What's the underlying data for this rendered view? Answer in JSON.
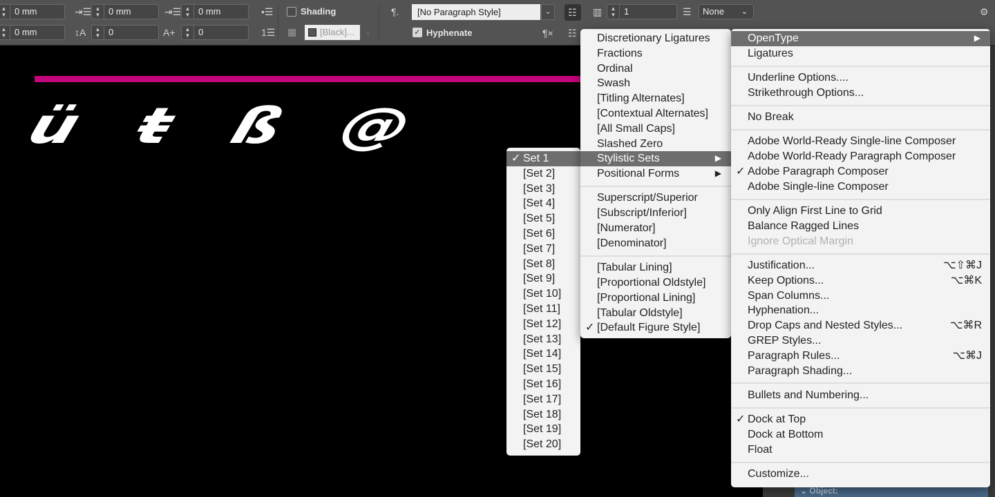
{
  "toolbar": {
    "left_indent": "0 mm",
    "first_indent": "0 mm",
    "space_before_label": "0 mm",
    "row2_indent": "0 mm",
    "drop_lines": "0",
    "drop_chars": "0",
    "shading_label": "Shading",
    "shading_color": "[Black]...",
    "paragraph_style": "[No Paragraph Style]",
    "hyphenate_label": "Hyphenate",
    "columns": "1",
    "span": "None"
  },
  "canvas": {
    "glyphs": "ü ŧ ß @",
    "rule_color": "#c4067c"
  },
  "panel": {
    "header": "Object:"
  },
  "sets_menu": [
    {
      "label": "Set 1",
      "checked": true,
      "highlighted": true
    },
    {
      "label": "[Set 2]"
    },
    {
      "label": "[Set 3]"
    },
    {
      "label": "[Set 4]"
    },
    {
      "label": "[Set 5]"
    },
    {
      "label": "[Set 6]"
    },
    {
      "label": "[Set 7]"
    },
    {
      "label": "[Set 8]"
    },
    {
      "label": "[Set 9]"
    },
    {
      "label": "[Set 10]"
    },
    {
      "label": "[Set 11]"
    },
    {
      "label": "[Set 12]"
    },
    {
      "label": "[Set 13]"
    },
    {
      "label": "[Set 14]"
    },
    {
      "label": "[Set 15]"
    },
    {
      "label": "[Set 16]"
    },
    {
      "label": "[Set 17]"
    },
    {
      "label": "[Set 18]"
    },
    {
      "label": "[Set 19]"
    },
    {
      "label": "[Set 20]"
    }
  ],
  "opentype_menu": [
    {
      "label": "Discretionary Ligatures"
    },
    {
      "label": "Fractions"
    },
    {
      "label": "Ordinal"
    },
    {
      "label": "Swash"
    },
    {
      "label": "[Titling Alternates]"
    },
    {
      "label": "[Contextual Alternates]"
    },
    {
      "label": "[All Small Caps]"
    },
    {
      "label": "Slashed Zero"
    },
    {
      "label": "Stylistic Sets",
      "submenu": true,
      "highlighted": true
    },
    {
      "label": "Positional Forms",
      "submenu": true
    },
    {
      "separator": true
    },
    {
      "label": "Superscript/Superior"
    },
    {
      "label": "[Subscript/Inferior]"
    },
    {
      "label": "[Numerator]"
    },
    {
      "label": "[Denominator]"
    },
    {
      "separator": true
    },
    {
      "label": "[Tabular Lining]"
    },
    {
      "label": "[Proportional Oldstyle]"
    },
    {
      "label": "[Proportional Lining]"
    },
    {
      "label": "[Tabular Oldstyle]"
    },
    {
      "label": "[Default Figure Style]",
      "checked": true
    }
  ],
  "main_menu": [
    {
      "label": "OpenType",
      "submenu": true,
      "highlighted": true
    },
    {
      "label": "Ligatures"
    },
    {
      "separator": true
    },
    {
      "label": "Underline Options...."
    },
    {
      "label": "Strikethrough Options..."
    },
    {
      "separator": true
    },
    {
      "label": "No Break"
    },
    {
      "separator": true
    },
    {
      "label": "Adobe World-Ready Single-line Composer"
    },
    {
      "label": "Adobe World-Ready Paragraph Composer"
    },
    {
      "label": "Adobe Paragraph Composer",
      "checked": true
    },
    {
      "label": "Adobe Single-line Composer"
    },
    {
      "separator": true
    },
    {
      "label": "Only Align First Line to Grid"
    },
    {
      "label": "Balance Ragged Lines"
    },
    {
      "label": "Ignore Optical Margin",
      "disabled": true
    },
    {
      "separator": true
    },
    {
      "label": "Justification...",
      "shortcut": "⌥⇧⌘J"
    },
    {
      "label": "Keep Options...",
      "shortcut": "⌥⌘K"
    },
    {
      "label": "Span Columns..."
    },
    {
      "label": "Hyphenation..."
    },
    {
      "label": "Drop Caps and Nested Styles...",
      "shortcut": "⌥⌘R"
    },
    {
      "label": "GREP Styles..."
    },
    {
      "label": "Paragraph Rules...",
      "shortcut": "⌥⌘J"
    },
    {
      "label": "Paragraph Shading..."
    },
    {
      "separator": true
    },
    {
      "label": "Bullets and Numbering..."
    },
    {
      "separator": true
    },
    {
      "label": "Dock at Top",
      "checked": true
    },
    {
      "label": "Dock at Bottom"
    },
    {
      "label": "Float"
    },
    {
      "separator": true
    },
    {
      "label": "Customize..."
    }
  ]
}
